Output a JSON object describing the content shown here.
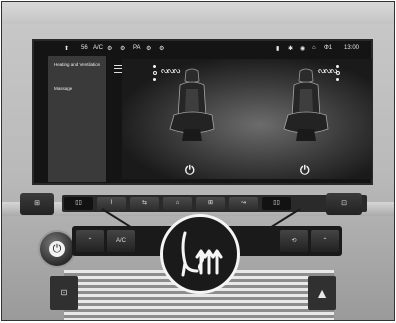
{
  "screen": {
    "status": {
      "left_items": [
        "⬆",
        "56",
        "A/C",
        "⚙",
        "⚙",
        "PA",
        "⚙",
        "⚙"
      ],
      "right_items": [
        "▮",
        "✱",
        "◉",
        "⌂",
        "Φ1"
      ],
      "time": "13:00"
    },
    "menu": {
      "items": [
        {
          "label": "Heating and Ventilation"
        },
        {
          "label": "Massage"
        }
      ]
    },
    "left_seat": {
      "heat_icon": "seat-heat-icon",
      "power_icon": "power-icon"
    },
    "right_seat": {
      "heat_icon": "seat-heat-icon",
      "power_icon": "power-icon"
    }
  },
  "console": {
    "top_buttons": [
      "⊞",
      "▯▯",
      "⌇",
      "⇆",
      "⌂",
      "⊞",
      "↝",
      "▯▯",
      "⊡"
    ],
    "climate_buttons": [
      "⊡",
      "⌃",
      "A/C",
      "",
      "",
      "",
      "",
      "⟲",
      "⌃"
    ],
    "knob_icon": "power-icon",
    "hazard_icon": "hazard-icon",
    "lock_icon": "lock-icon"
  },
  "callout": {
    "icon": "seat-heat-icon"
  }
}
